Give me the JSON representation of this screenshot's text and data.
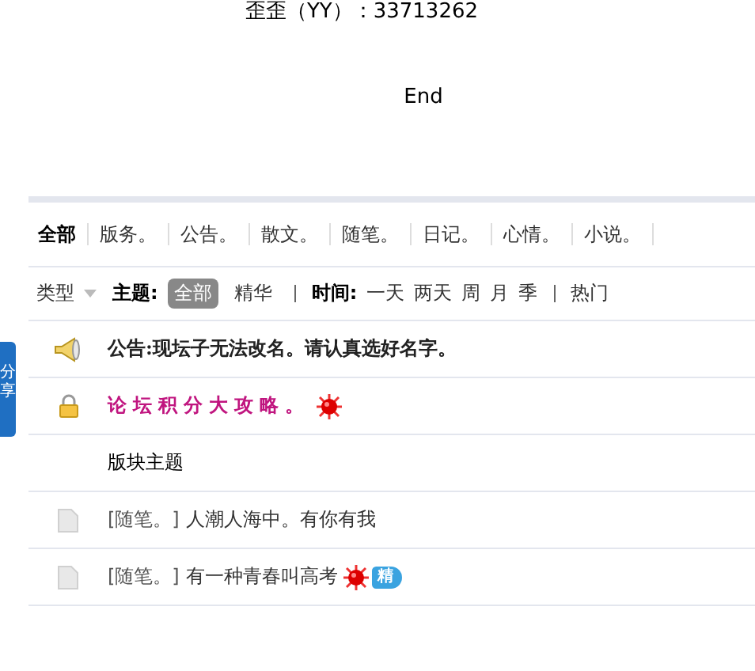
{
  "contact": "歪歪（YY）：33713262",
  "end": "End",
  "share": {
    "label": "分享"
  },
  "categories": [
    {
      "label": "全部",
      "selected": true
    },
    {
      "label": "版务。",
      "selected": false
    },
    {
      "label": "公告。",
      "selected": false
    },
    {
      "label": "散文。",
      "selected": false
    },
    {
      "label": "随笔。",
      "selected": false
    },
    {
      "label": "日记。",
      "selected": false
    },
    {
      "label": "心情。",
      "selected": false
    },
    {
      "label": "小说。",
      "selected": false
    }
  ],
  "filter": {
    "type_label": "类型",
    "theme_label": "主题:",
    "themes": [
      {
        "label": "全部",
        "selected": true
      },
      {
        "label": "精华",
        "selected": false
      }
    ],
    "time_label": "时间:",
    "times": [
      "一天",
      "两天",
      "周",
      "月",
      "季"
    ],
    "hot": "热门"
  },
  "notices": [
    {
      "kind": "announcement",
      "label": "公告:",
      "text": "现坛子无法改名。请认真选好名字。",
      "hot": false
    },
    {
      "kind": "locked",
      "text": "论坛积分大攻略。",
      "hot": true
    }
  ],
  "section": "版块主题",
  "threads": [
    {
      "category": "[随笔。]",
      "title": "人潮人海中。有你有我",
      "hot": false,
      "digest": false
    },
    {
      "category": "[随笔。]",
      "title": "有一种青春叫高考",
      "hot": true,
      "digest": true,
      "digest_label": "精"
    }
  ]
}
